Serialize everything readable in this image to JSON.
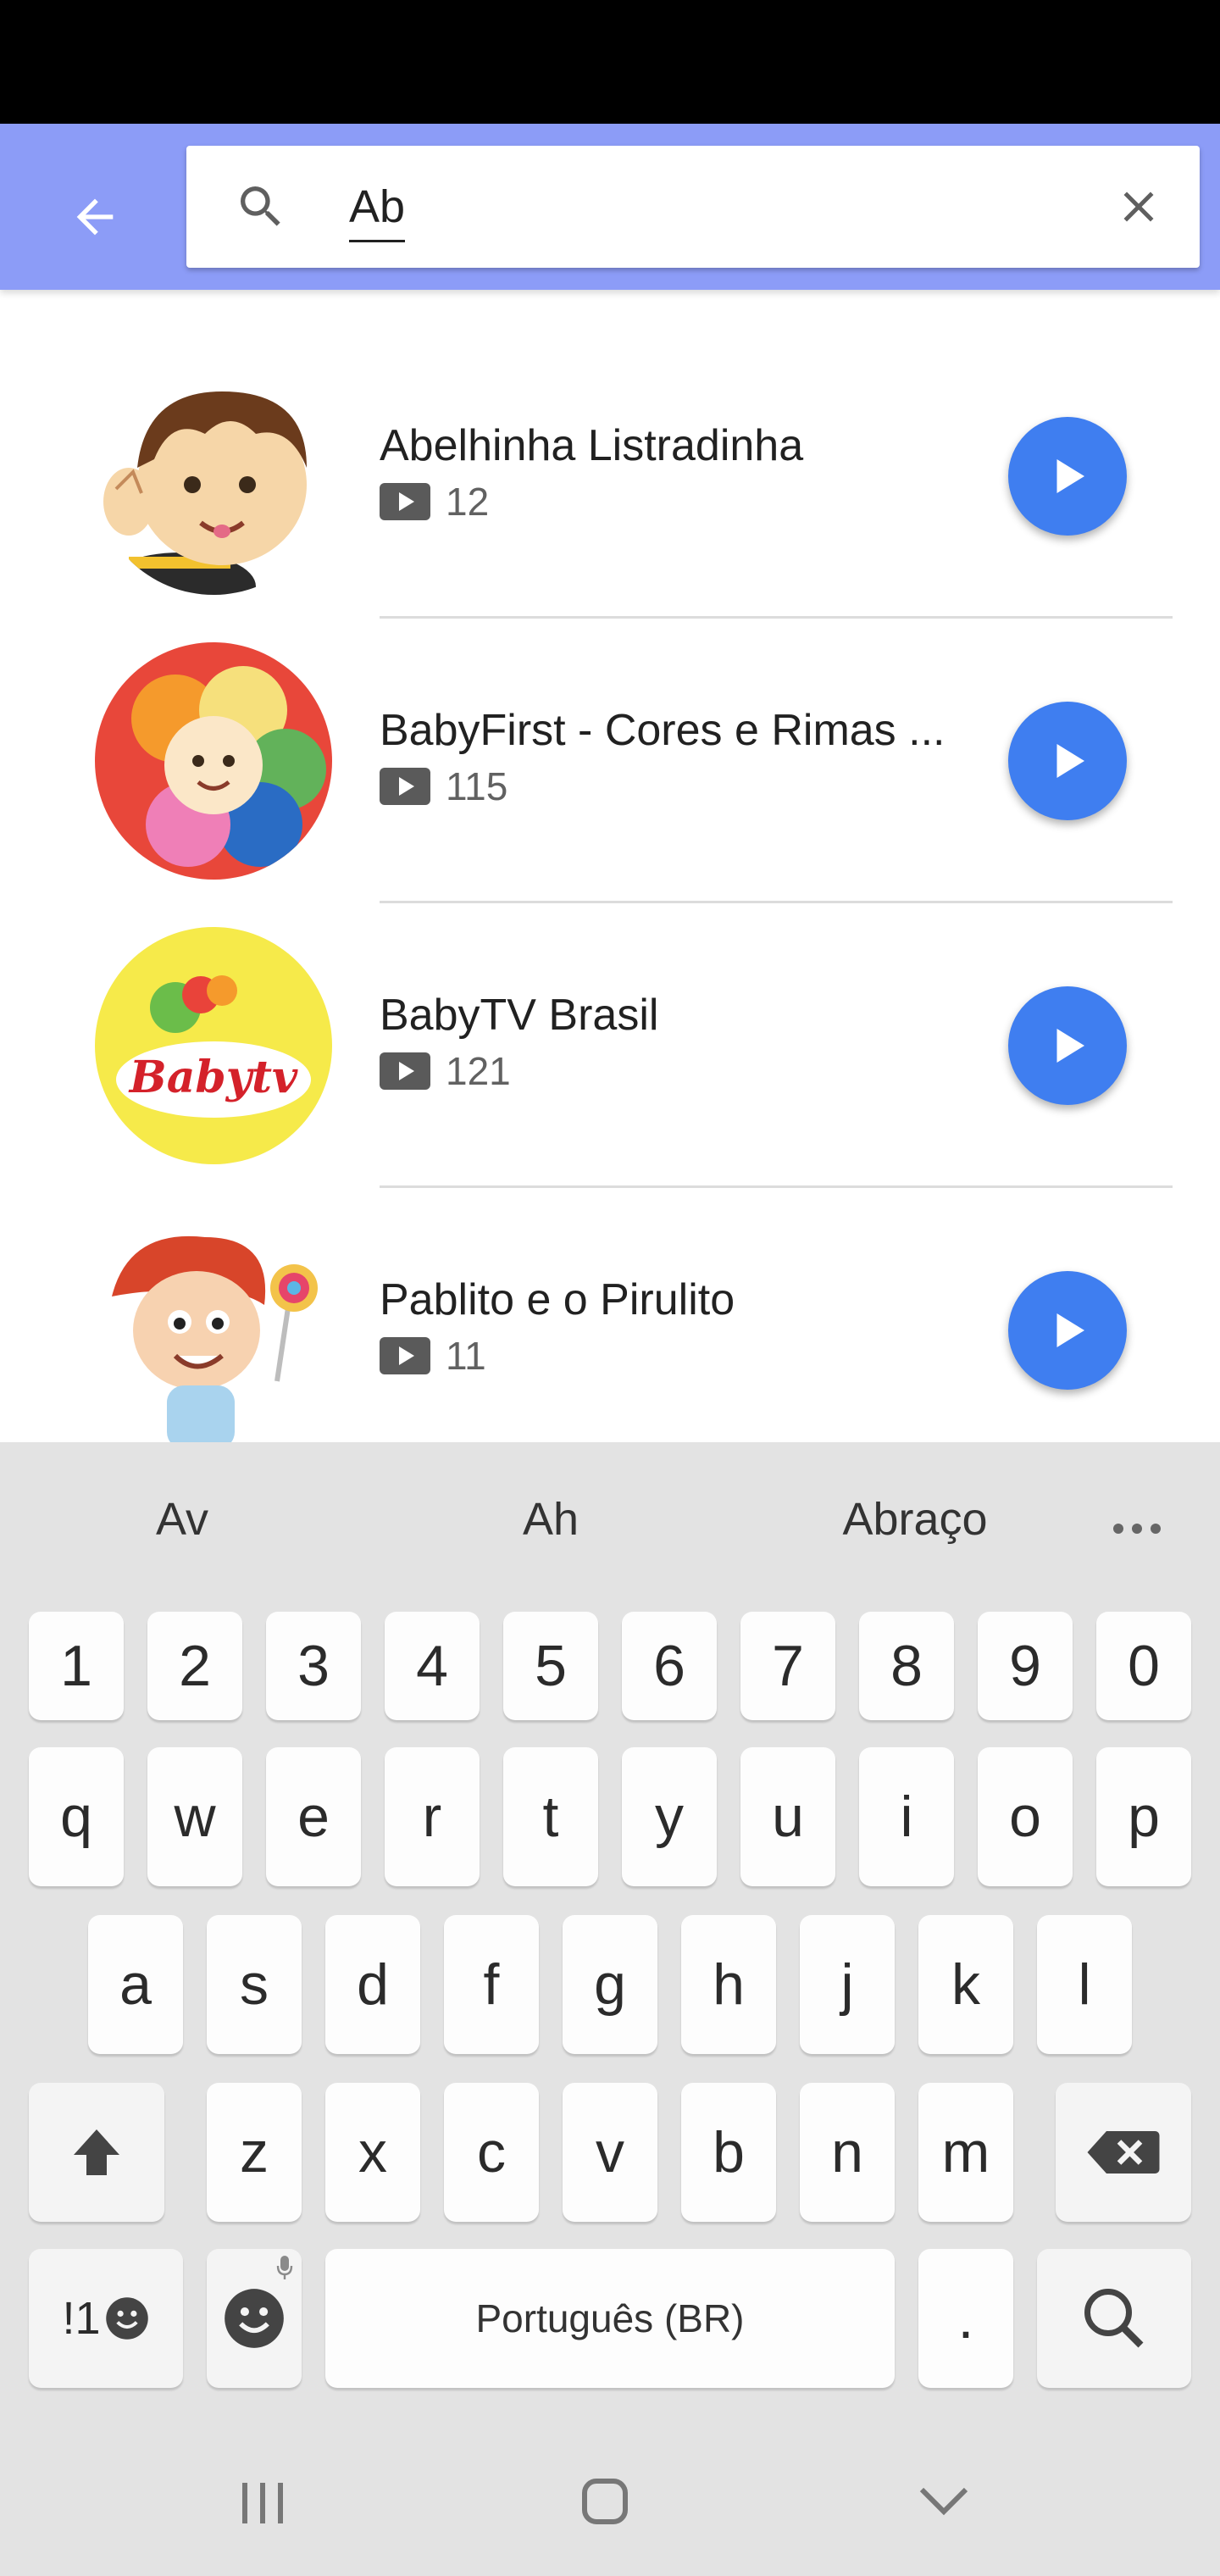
{
  "search": {
    "query": "Ab"
  },
  "results": [
    {
      "title": "Abelhinha Listradinha",
      "count": "12"
    },
    {
      "title": "BabyFirst - Cores e Rimas ...",
      "count": "115"
    },
    {
      "title": "BabyTV Brasil",
      "count": "121"
    },
    {
      "title": "Pablito e o Pirulito",
      "count": "11"
    }
  ],
  "avatar_texts": {
    "babytv_logo": "Babytv"
  },
  "keyboard": {
    "suggestions": [
      "Av",
      "Ah",
      "Abraço"
    ],
    "number_row": [
      "1",
      "2",
      "3",
      "4",
      "5",
      "6",
      "7",
      "8",
      "9",
      "0"
    ],
    "row1": [
      "q",
      "w",
      "e",
      "r",
      "t",
      "y",
      "u",
      "i",
      "o",
      "p"
    ],
    "row2": [
      "a",
      "s",
      "d",
      "f",
      "g",
      "h",
      "j",
      "k",
      "l"
    ],
    "row3": [
      "z",
      "x",
      "c",
      "v",
      "b",
      "n",
      "m"
    ],
    "symbols_key": "!1",
    "space_label": "Português (BR)",
    "period_key": "."
  },
  "colors": {
    "app_bar": "#8c9cf7",
    "play_button": "#3f7ef0",
    "keyboard_bg": "#e3e3e3"
  }
}
